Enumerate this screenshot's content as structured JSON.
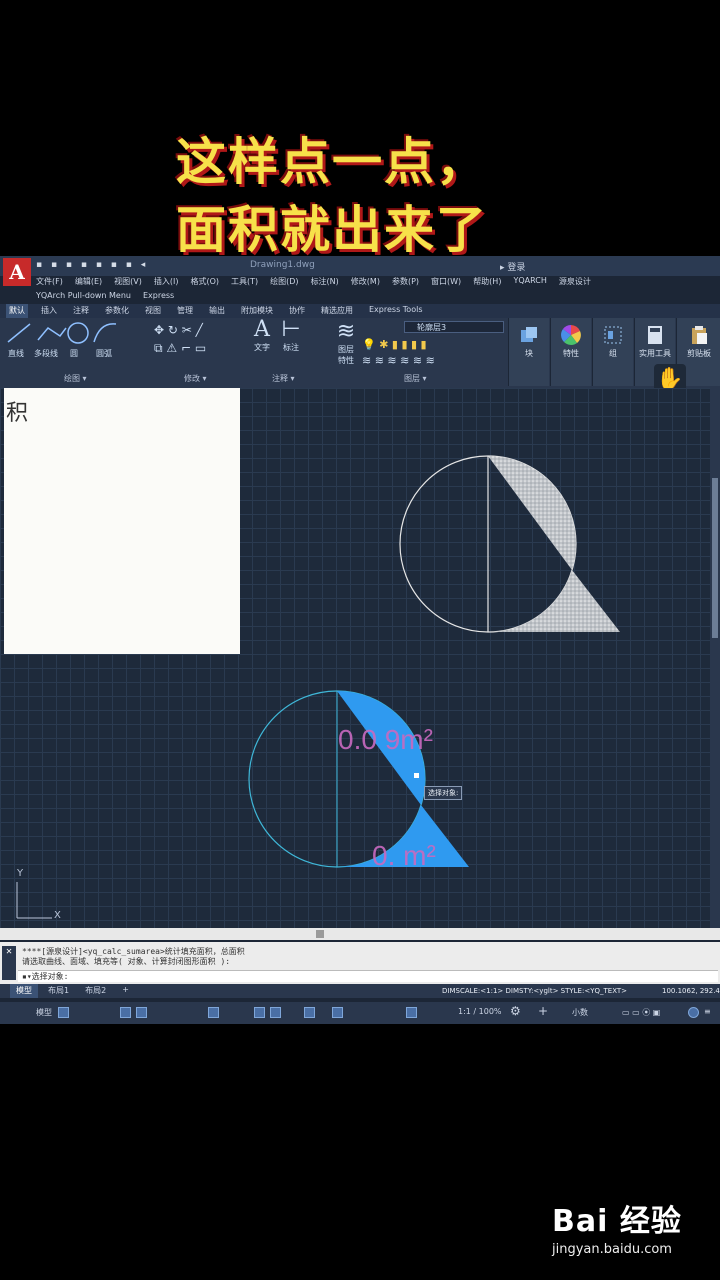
{
  "caption": {
    "line1": "这样点一点，",
    "line2": "面积就出来了"
  },
  "app": {
    "logo": "A",
    "quick_access": "▪ ▪ ▪ ▪ ▪ ▪ ▪ ◂",
    "title": "Drawing1.dwg",
    "search": "▸ 登录"
  },
  "menubar": [
    "文件(F)",
    "编辑(E)",
    "视图(V)",
    "插入(I)",
    "格式(O)",
    "工具(T)",
    "绘图(D)",
    "标注(N)",
    "修改(M)",
    "参数(P)",
    "窗口(W)",
    "帮助(H)",
    "YQARCH",
    "源泉设计"
  ],
  "submenu": [
    "YQArch Pull-down Menu",
    "Express"
  ],
  "tabs": [
    "默认",
    "插入",
    "注释",
    "参数化",
    "视图",
    "管理",
    "输出",
    "附加模块",
    "协作",
    "精选应用",
    "Express Tools"
  ],
  "ribbon": {
    "draw_buttons": [
      "直线",
      "多段线",
      "圆",
      "圆弧"
    ],
    "panel_draw": "绘图 ▾",
    "panel_modify": "修改 ▾",
    "text_btn": "文字",
    "dim_btn": "标注",
    "panel_annotation": "注释 ▾",
    "layer_btn1": "图层",
    "layer_btn2": "特性",
    "layer_select": "轮廓层3",
    "panel_layer": "图层 ▾",
    "big_tools": [
      "块",
      "特性",
      "组",
      "实用工具",
      "剪贴板"
    ]
  },
  "white_panel_text": [
    "积"
  ],
  "drawing": {
    "area_label_top": "0.0  9m²",
    "area_label_bottom": "0.   m²",
    "tooltip": "选择对象:",
    "ucs_x": "X",
    "ucs_y": "Y"
  },
  "command": {
    "line1": "****[源泉设计]<yq_calc_sumarea>统计填充面积，总面积",
    "line2": "请选取曲线、面域、填充等( 对象、计算封闭图形面积 ):",
    "prompt": "▪▾选择对象:"
  },
  "layout_tabs": [
    "模型",
    "布局1",
    "布局2",
    "+"
  ],
  "dimscale": "DIMSCALE:<1:1> DIMSTY:<yglt> STYLE:<YQ_TEXT>",
  "coords": "100.1062, 292.45",
  "status": {
    "model": "模型",
    "scale": "1:1 / 100%",
    "unit": "小数"
  },
  "watermark": {
    "logo": "Bai 经验",
    "url": "jingyan.baidu.com"
  },
  "colors": {
    "selection_fill": "#2f9af0",
    "hatch": "#d8d8d8",
    "cad_bg": "#1e2a3b",
    "caption": "#f7e14a"
  }
}
